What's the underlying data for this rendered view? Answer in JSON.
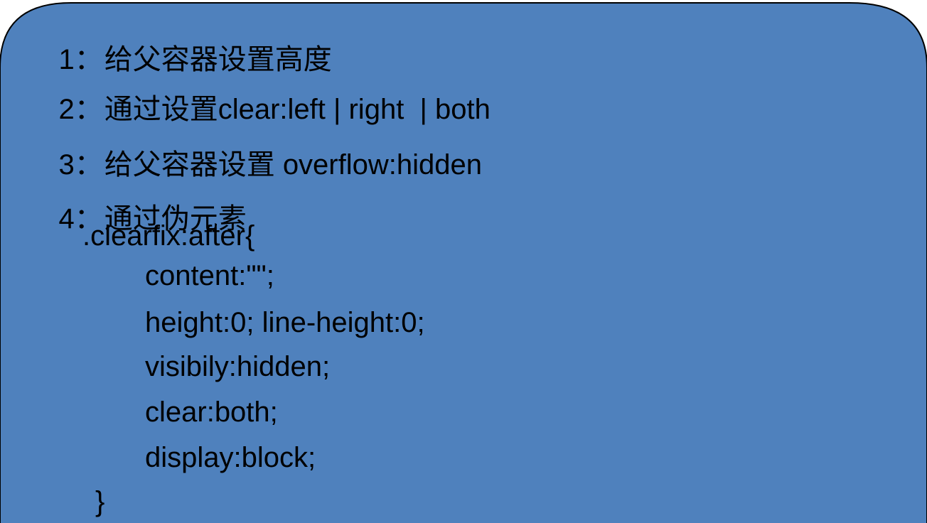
{
  "colors": {
    "panel_fill": "#4f81bd",
    "panel_stroke": "#000000",
    "text": "#000000"
  },
  "items": [
    {
      "number": "1",
      "separator": "：",
      "text": "给父容器设置高度"
    },
    {
      "number": "2",
      "separator": "：",
      "text": "通过设置clear:left | right  | both"
    },
    {
      "number": "3",
      "separator": "：",
      "text": "给父容器设置 overflow:hidden"
    },
    {
      "number": "4",
      "separator": "：",
      "text": "通过伪元素"
    }
  ],
  "code": {
    "selector": ".clearfix:after{",
    "declarations": [
      "content:\"\";",
      "height:0; line-height:0;",
      "visibily:hidden;",
      "clear:both;",
      "display:block;"
    ],
    "closing": "}"
  }
}
